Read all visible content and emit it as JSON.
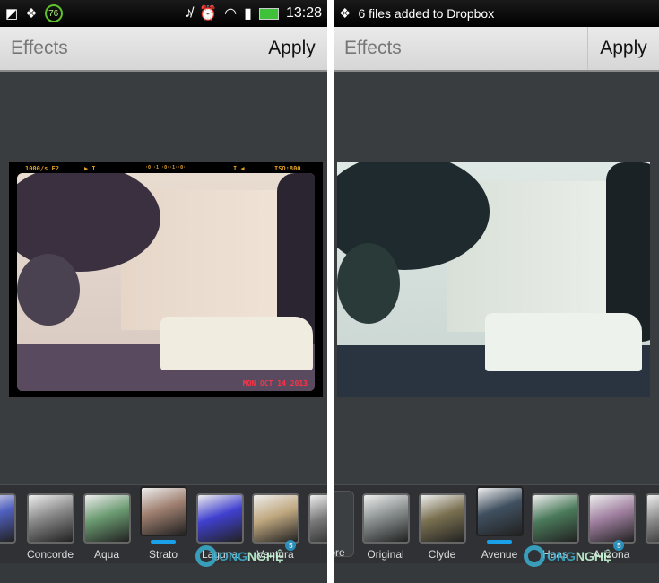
{
  "colors": {
    "accent": "#1aa0e8",
    "background": "#3a3d40",
    "header": "#e0e0e0"
  },
  "left": {
    "status": {
      "icons": [
        "sim-icon",
        "dropbox-icon",
        "battery-badge-icon",
        "mute-icon",
        "alarm-icon",
        "wifi-icon",
        "signal-icon",
        "battery-icon"
      ],
      "badge": "76",
      "time": "13:28"
    },
    "header": {
      "title": "Effects",
      "apply": "Apply"
    },
    "frame": {
      "shutter": "1000/s F2",
      "play": "▶ I",
      "scale": "·0··1··0··1··0·",
      "rewind": "I ◀",
      "iso": "ISO:800",
      "date": "MON OCT 14 2013"
    },
    "filters": [
      {
        "label": "w",
        "selected": false
      },
      {
        "label": "Concorde",
        "selected": false
      },
      {
        "label": "Aqua",
        "selected": false
      },
      {
        "label": "Strato",
        "selected": true
      },
      {
        "label": "Laguna",
        "selected": false
      },
      {
        "label": "Ventura",
        "selected": false
      },
      {
        "label": "B",
        "selected": false
      }
    ]
  },
  "right": {
    "status": {
      "notification": "6 files added to Dropbox"
    },
    "header": {
      "title": "Effects",
      "apply": "Apply"
    },
    "more_label": "ore",
    "filters": [
      {
        "label": "Original",
        "selected": false
      },
      {
        "label": "Clyde",
        "selected": false
      },
      {
        "label": "Avenue",
        "selected": true
      },
      {
        "label": "Haas",
        "selected": false
      },
      {
        "label": "Arizona",
        "selected": false
      },
      {
        "label": "",
        "selected": false
      }
    ]
  },
  "watermark": {
    "text1": "ONG",
    "text2": "NGHỆ",
    "badge": "5"
  }
}
